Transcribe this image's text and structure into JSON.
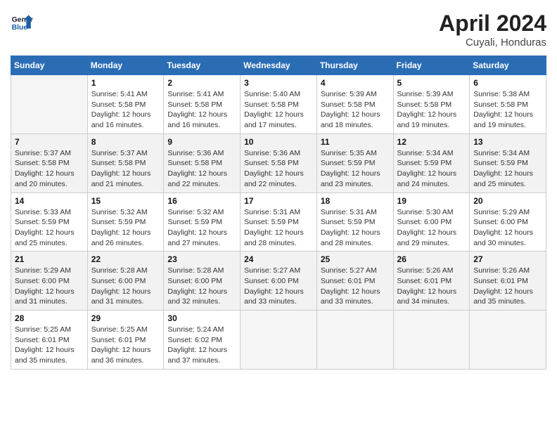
{
  "header": {
    "logo_line1": "General",
    "logo_line2": "Blue",
    "month": "April 2024",
    "location": "Cuyali, Honduras"
  },
  "days_of_week": [
    "Sunday",
    "Monday",
    "Tuesday",
    "Wednesday",
    "Thursday",
    "Friday",
    "Saturday"
  ],
  "weeks": [
    [
      {
        "day": "",
        "info": ""
      },
      {
        "day": "1",
        "info": "Sunrise: 5:41 AM\nSunset: 5:58 PM\nDaylight: 12 hours\nand 16 minutes."
      },
      {
        "day": "2",
        "info": "Sunrise: 5:41 AM\nSunset: 5:58 PM\nDaylight: 12 hours\nand 16 minutes."
      },
      {
        "day": "3",
        "info": "Sunrise: 5:40 AM\nSunset: 5:58 PM\nDaylight: 12 hours\nand 17 minutes."
      },
      {
        "day": "4",
        "info": "Sunrise: 5:39 AM\nSunset: 5:58 PM\nDaylight: 12 hours\nand 18 minutes."
      },
      {
        "day": "5",
        "info": "Sunrise: 5:39 AM\nSunset: 5:58 PM\nDaylight: 12 hours\nand 19 minutes."
      },
      {
        "day": "6",
        "info": "Sunrise: 5:38 AM\nSunset: 5:58 PM\nDaylight: 12 hours\nand 19 minutes."
      }
    ],
    [
      {
        "day": "7",
        "info": "Sunrise: 5:37 AM\nSunset: 5:58 PM\nDaylight: 12 hours\nand 20 minutes."
      },
      {
        "day": "8",
        "info": "Sunrise: 5:37 AM\nSunset: 5:58 PM\nDaylight: 12 hours\nand 21 minutes."
      },
      {
        "day": "9",
        "info": "Sunrise: 5:36 AM\nSunset: 5:58 PM\nDaylight: 12 hours\nand 22 minutes."
      },
      {
        "day": "10",
        "info": "Sunrise: 5:36 AM\nSunset: 5:58 PM\nDaylight: 12 hours\nand 22 minutes."
      },
      {
        "day": "11",
        "info": "Sunrise: 5:35 AM\nSunset: 5:59 PM\nDaylight: 12 hours\nand 23 minutes."
      },
      {
        "day": "12",
        "info": "Sunrise: 5:34 AM\nSunset: 5:59 PM\nDaylight: 12 hours\nand 24 minutes."
      },
      {
        "day": "13",
        "info": "Sunrise: 5:34 AM\nSunset: 5:59 PM\nDaylight: 12 hours\nand 25 minutes."
      }
    ],
    [
      {
        "day": "14",
        "info": "Sunrise: 5:33 AM\nSunset: 5:59 PM\nDaylight: 12 hours\nand 25 minutes."
      },
      {
        "day": "15",
        "info": "Sunrise: 5:32 AM\nSunset: 5:59 PM\nDaylight: 12 hours\nand 26 minutes."
      },
      {
        "day": "16",
        "info": "Sunrise: 5:32 AM\nSunset: 5:59 PM\nDaylight: 12 hours\nand 27 minutes."
      },
      {
        "day": "17",
        "info": "Sunrise: 5:31 AM\nSunset: 5:59 PM\nDaylight: 12 hours\nand 28 minutes."
      },
      {
        "day": "18",
        "info": "Sunrise: 5:31 AM\nSunset: 5:59 PM\nDaylight: 12 hours\nand 28 minutes."
      },
      {
        "day": "19",
        "info": "Sunrise: 5:30 AM\nSunset: 6:00 PM\nDaylight: 12 hours\nand 29 minutes."
      },
      {
        "day": "20",
        "info": "Sunrise: 5:29 AM\nSunset: 6:00 PM\nDaylight: 12 hours\nand 30 minutes."
      }
    ],
    [
      {
        "day": "21",
        "info": "Sunrise: 5:29 AM\nSunset: 6:00 PM\nDaylight: 12 hours\nand 31 minutes."
      },
      {
        "day": "22",
        "info": "Sunrise: 5:28 AM\nSunset: 6:00 PM\nDaylight: 12 hours\nand 31 minutes."
      },
      {
        "day": "23",
        "info": "Sunrise: 5:28 AM\nSunset: 6:00 PM\nDaylight: 12 hours\nand 32 minutes."
      },
      {
        "day": "24",
        "info": "Sunrise: 5:27 AM\nSunset: 6:00 PM\nDaylight: 12 hours\nand 33 minutes."
      },
      {
        "day": "25",
        "info": "Sunrise: 5:27 AM\nSunset: 6:01 PM\nDaylight: 12 hours\nand 33 minutes."
      },
      {
        "day": "26",
        "info": "Sunrise: 5:26 AM\nSunset: 6:01 PM\nDaylight: 12 hours\nand 34 minutes."
      },
      {
        "day": "27",
        "info": "Sunrise: 5:26 AM\nSunset: 6:01 PM\nDaylight: 12 hours\nand 35 minutes."
      }
    ],
    [
      {
        "day": "28",
        "info": "Sunrise: 5:25 AM\nSunset: 6:01 PM\nDaylight: 12 hours\nand 35 minutes."
      },
      {
        "day": "29",
        "info": "Sunrise: 5:25 AM\nSunset: 6:01 PM\nDaylight: 12 hours\nand 36 minutes."
      },
      {
        "day": "30",
        "info": "Sunrise: 5:24 AM\nSunset: 6:02 PM\nDaylight: 12 hours\nand 37 minutes."
      },
      {
        "day": "",
        "info": ""
      },
      {
        "day": "",
        "info": ""
      },
      {
        "day": "",
        "info": ""
      },
      {
        "day": "",
        "info": ""
      }
    ]
  ]
}
